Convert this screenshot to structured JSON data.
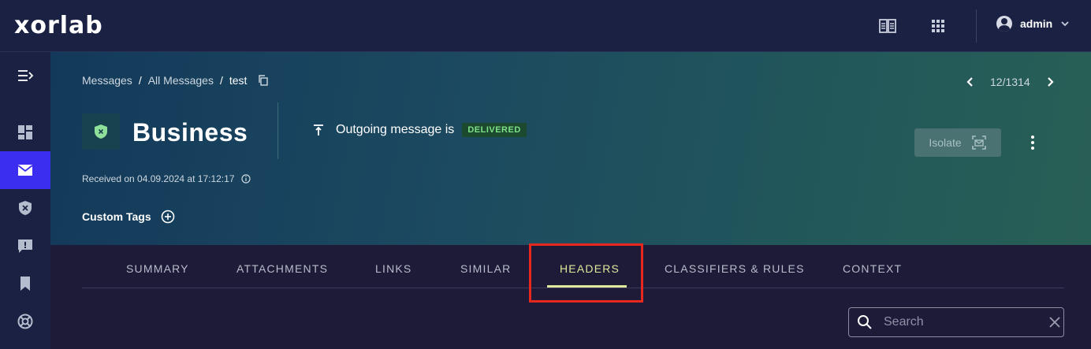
{
  "app": {
    "logo": "xorlab"
  },
  "topbar": {
    "user": "admin"
  },
  "breadcrumb": {
    "items": [
      "Messages",
      "All Messages",
      "test"
    ],
    "separator": "/"
  },
  "pager": {
    "position": "12/1314"
  },
  "message": {
    "brand": "Business",
    "direction_text": "Outgoing message is",
    "status": "DELIVERED",
    "received": "Received on 04.09.2024 at 17:12:17",
    "custom_tags_label": "Custom Tags"
  },
  "actions": {
    "isolate_label": "Isolate"
  },
  "tabs": [
    {
      "label": "SUMMARY"
    },
    {
      "label": "ATTACHMENTS"
    },
    {
      "label": "LINKS"
    },
    {
      "label": "SIMILAR"
    },
    {
      "label": "HEADERS",
      "active": true
    },
    {
      "label": "CLASSIFIERS & RULES"
    },
    {
      "label": "CONTEXT"
    }
  ],
  "search": {
    "placeholder": "Search",
    "value": ""
  },
  "colors": {
    "active_nav": "#3b2ef0",
    "active_tab": "#dfe89a",
    "badge_text": "#7fe08a",
    "highlight": "#e8281e"
  }
}
